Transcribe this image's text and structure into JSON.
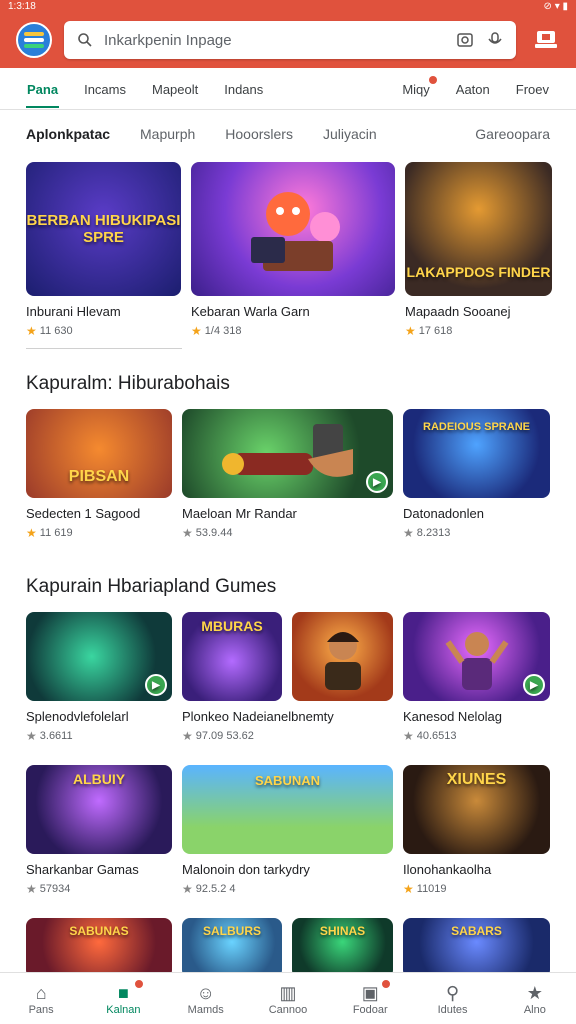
{
  "status": {
    "time": "1:3:18",
    "icons": "⊘ ▾ ▮"
  },
  "search": {
    "placeholder": "Inkarkpenin Inpage"
  },
  "tabs": [
    "Pana",
    "Incams",
    "Mapeolt",
    "Indans",
    "Miqy",
    "Aaton",
    "Froev"
  ],
  "chips": [
    "Aplonkpatac",
    "Mapurph",
    "Hooorslers",
    "Juliyacin",
    "Gareoopara"
  ],
  "row1": [
    {
      "name": "Inburani Hlevam",
      "rating": "11 630",
      "art": "BERBAN HIBUKIPASI SPRE"
    },
    {
      "name": "Kebaran Warla Garn",
      "rating": "1/4 318",
      "art": ""
    },
    {
      "name": "Mapaadn Sooanej",
      "rating": "17 618",
      "art": "LAKAPPDOS FINDER"
    }
  ],
  "section2": {
    "title": "Kapuralm: Hiburabohais"
  },
  "row2": [
    {
      "name": "Sedecten 1 Sagood",
      "rating": "11 619",
      "art": "PIBSAN"
    },
    {
      "name": "Maeloan Mr Randar",
      "rating": "53.9.44",
      "art": ""
    },
    {
      "name": "Datonadonlen",
      "rating": "8.2313",
      "art": "RADEIOUS SPRANE"
    }
  ],
  "section3": {
    "title": "Kapurain Hbariapland Gumes"
  },
  "row3": [
    {
      "name": "Splenodvlefolelarl",
      "rating": "3.6611",
      "art": ""
    },
    {
      "name": "Plonkeo Nadeianelbnemty",
      "rating": "97.09  53.62",
      "art": "MBURAS"
    },
    {
      "name": "Kanesod Nelolag",
      "rating": "40.6513",
      "art": ""
    }
  ],
  "row4": [
    {
      "name": "Sharkanbar Gamas",
      "rating": "57934",
      "art": "ALBUIY"
    },
    {
      "name": "Malonoin don tarkydry",
      "rating": "92.5.2 4",
      "art": "SABUNAN"
    },
    {
      "name": "Ilonohankaolha",
      "rating": "11019",
      "art": "XIUNES"
    }
  ],
  "row5": [
    {
      "art": "SABUNAS"
    },
    {
      "art": "SALBURS"
    },
    {
      "art": "SHINAS"
    },
    {
      "art": "SABARS"
    }
  ],
  "nav": [
    "Pans",
    "Kalnan",
    "Mamds",
    "Cannoo",
    "Fodoar",
    "Idutes",
    "Alno"
  ],
  "colors": {
    "brand": "#e0523d",
    "accent": "#01875f",
    "star": "#f4a31a"
  }
}
